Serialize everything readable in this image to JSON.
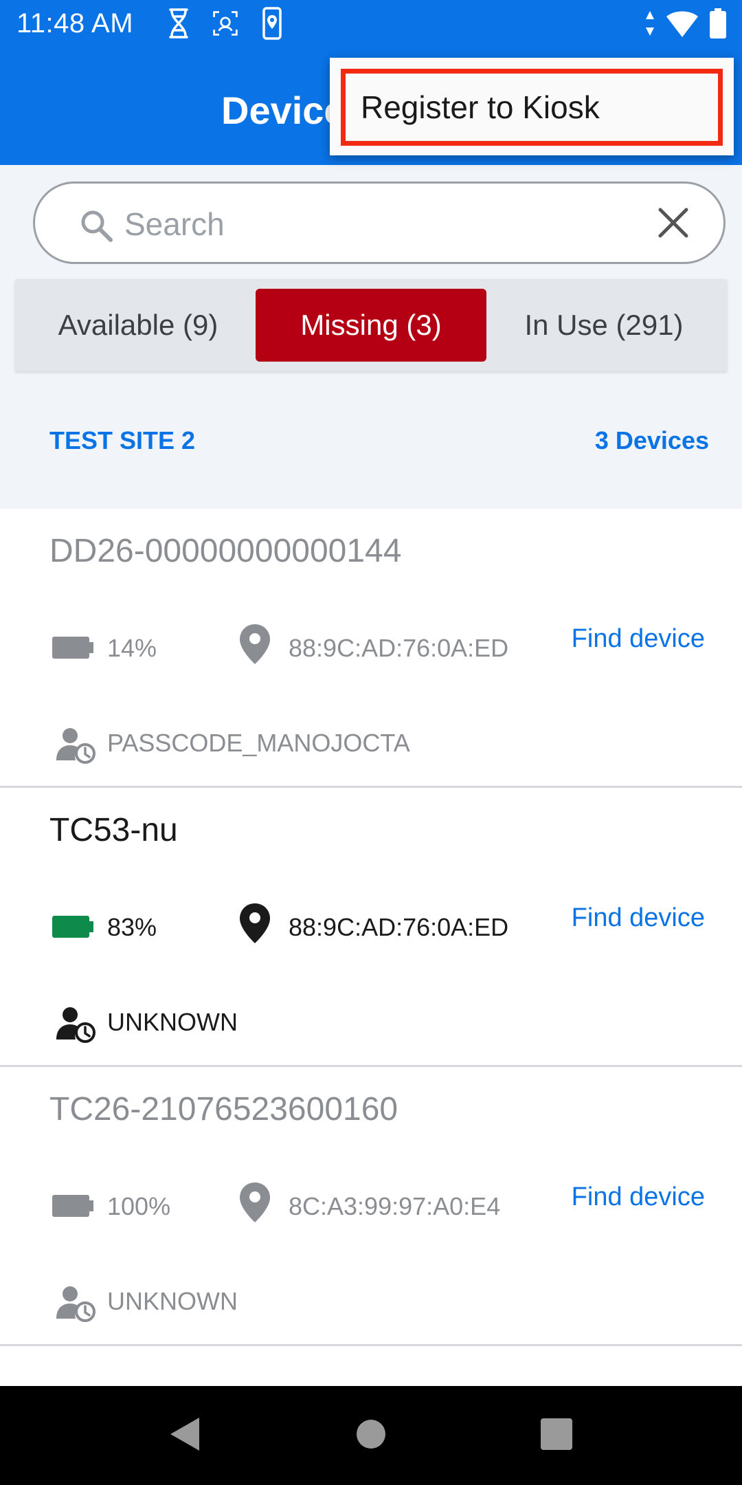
{
  "status_bar": {
    "time": "11:48 AM",
    "signal_badge": "6"
  },
  "app_bar": {
    "title": "Devices"
  },
  "overflow_menu": {
    "items": [
      {
        "label": "Register to Kiosk"
      }
    ]
  },
  "search": {
    "placeholder": "Search",
    "value": ""
  },
  "tabs": [
    {
      "label": "Available (9)",
      "active": false
    },
    {
      "label": "Missing (3)",
      "active": true
    },
    {
      "label": "In Use (291)",
      "active": false
    }
  ],
  "site": {
    "name": "TEST SITE 2",
    "count": "3 Devices"
  },
  "devices": [
    {
      "name": "DD26-00000000000144",
      "battery": "14%",
      "mac": "88:9C:AD:76:0A:ED",
      "action": "Find device",
      "user": "PASSCODE_MANOJOCTA",
      "state": "dim",
      "battery_color": "#8a8d91"
    },
    {
      "name": "TC53-nu",
      "battery": "83%",
      "mac": "88:9C:AD:76:0A:ED",
      "action": "Find device",
      "user": "UNKNOWN",
      "state": "active",
      "battery_color": "#0e8a4a"
    },
    {
      "name": "TC26-21076523600160",
      "battery": "100%",
      "mac": "8C:A3:99:97:A0:E4",
      "action": "Find device",
      "user": "UNKNOWN",
      "state": "dim",
      "battery_color": "#8a8d91"
    }
  ],
  "colors": {
    "primary": "#0a73e6",
    "tab_active": "#b50014",
    "highlight_border": "#f22a12"
  }
}
